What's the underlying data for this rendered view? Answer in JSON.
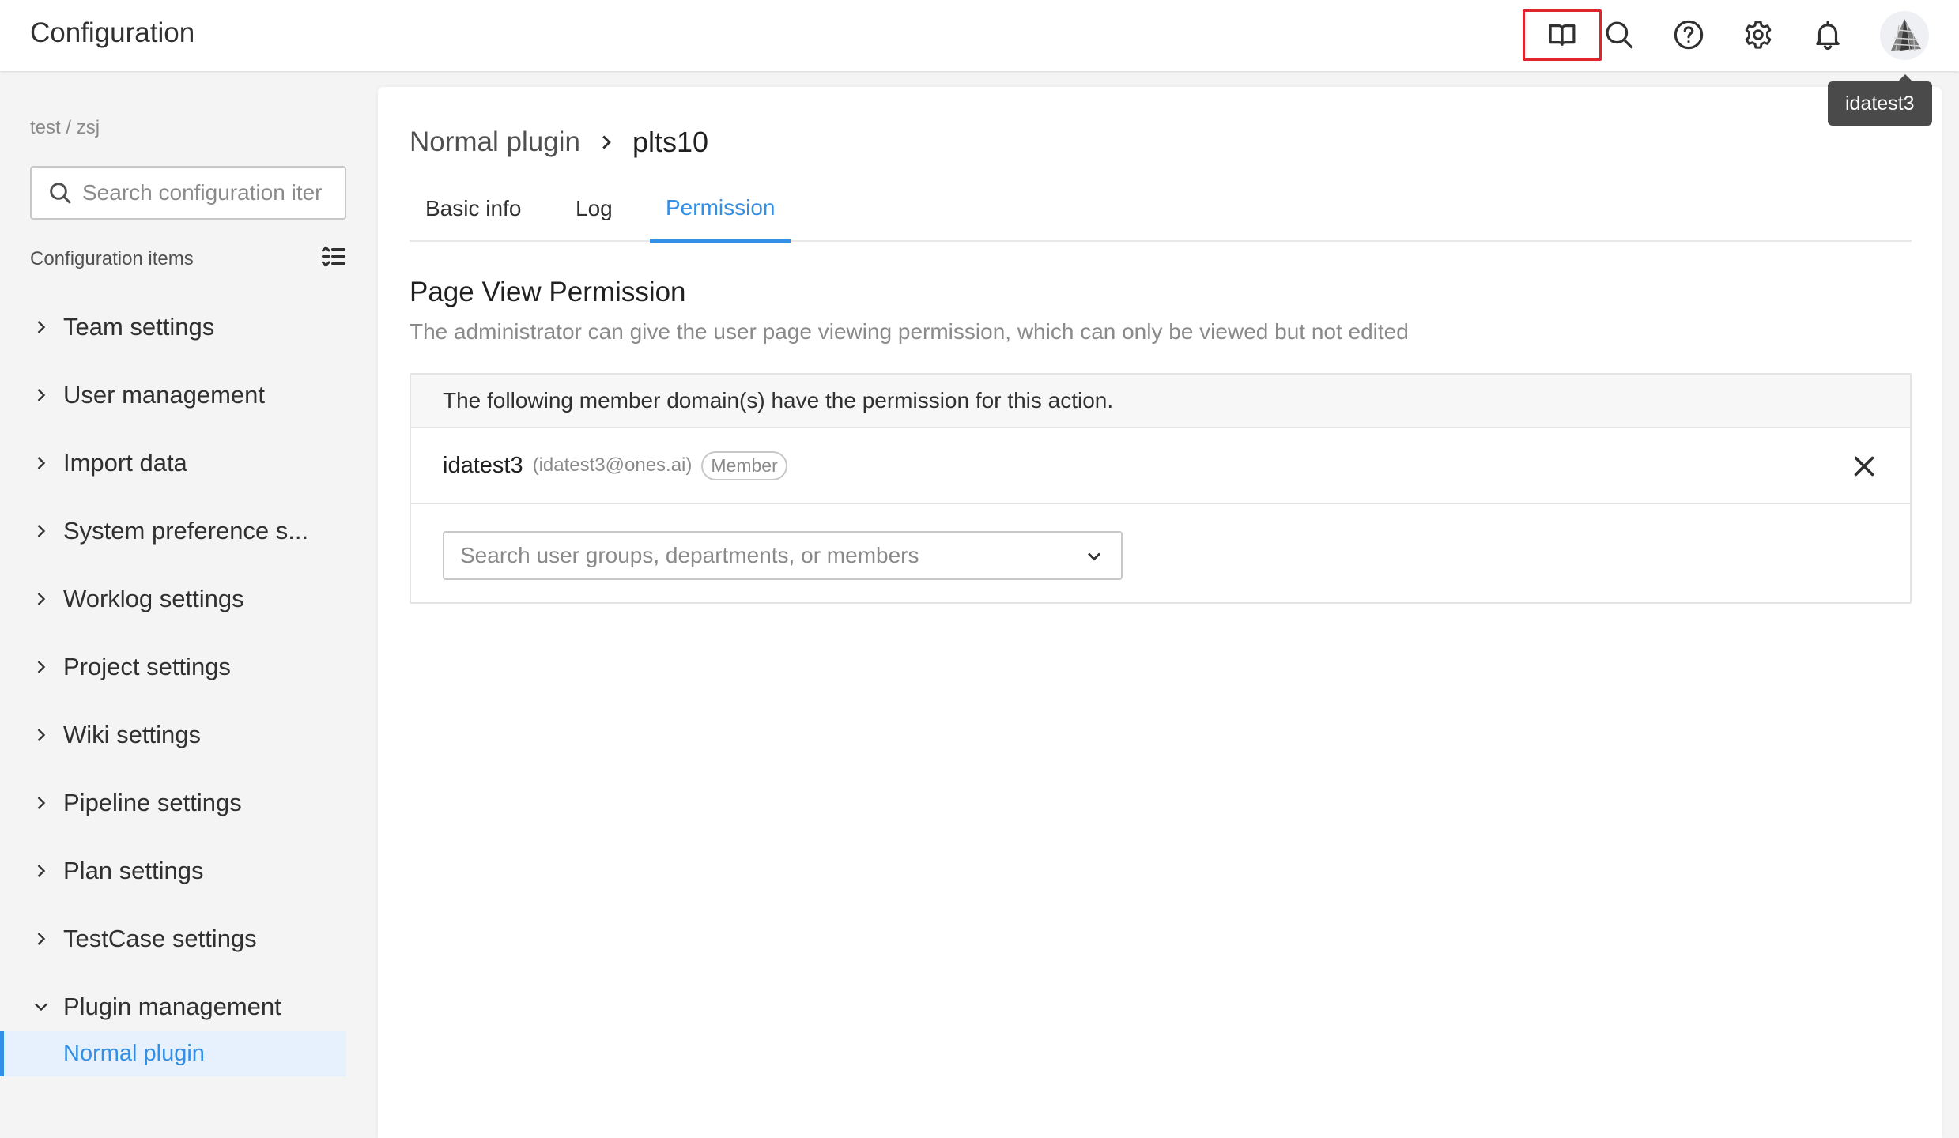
{
  "header": {
    "title": "Configuration",
    "icons": [
      "book-icon",
      "search-icon",
      "help-icon",
      "gear-icon",
      "bell-icon"
    ],
    "tooltip": "idatest3"
  },
  "sidebar": {
    "path": "test / zsj",
    "search_placeholder": "Search configuration iter",
    "section_label": "Configuration items",
    "items": [
      {
        "label": "Team settings",
        "expanded": false
      },
      {
        "label": "User management",
        "expanded": false
      },
      {
        "label": "Import data",
        "expanded": false
      },
      {
        "label": "System preference s...",
        "expanded": false
      },
      {
        "label": "Worklog settings",
        "expanded": false
      },
      {
        "label": "Project settings",
        "expanded": false
      },
      {
        "label": "Wiki settings",
        "expanded": false
      },
      {
        "label": "Pipeline settings",
        "expanded": false
      },
      {
        "label": "Plan settings",
        "expanded": false
      },
      {
        "label": "TestCase settings",
        "expanded": false
      },
      {
        "label": "Plugin management",
        "expanded": true
      }
    ],
    "sub_item": "Normal plugin"
  },
  "main": {
    "breadcrumb_parent": "Normal plugin",
    "breadcrumb_current": "plts10",
    "tabs": [
      {
        "label": "Basic info",
        "active": false
      },
      {
        "label": "Log",
        "active": false
      },
      {
        "label": "Permission",
        "active": true
      }
    ],
    "section_title": "Page View Permission",
    "section_desc": "The administrator can give the user page viewing permission, which can only be viewed but not edited",
    "perm_header": "The following member domain(s) have the permission for this action.",
    "member": {
      "name": "idatest3",
      "email": "(idatest3@ones.ai)",
      "badge": "Member"
    },
    "select_placeholder": "Search user groups, departments, or members"
  },
  "colors": {
    "accent": "#338fe5",
    "highlight": "#e0242c",
    "tooltip_bg": "#4a4a4a"
  }
}
